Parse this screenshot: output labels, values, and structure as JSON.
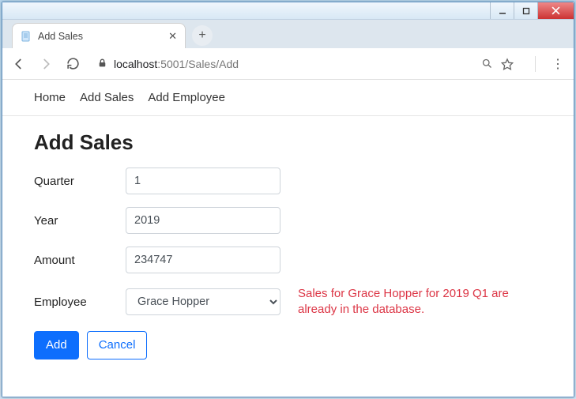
{
  "browser": {
    "tab_title": "Add Sales",
    "url_host": "localhost",
    "url_port": ":5001",
    "url_path": "/Sales/Add"
  },
  "nav": {
    "links": [
      "Home",
      "Add Sales",
      "Add Employee"
    ]
  },
  "page": {
    "heading": "Add Sales",
    "labels": {
      "quarter": "Quarter",
      "year": "Year",
      "amount": "Amount",
      "employee": "Employee"
    },
    "values": {
      "quarter": "1",
      "year": "2019",
      "amount": "234747",
      "employee": "Grace Hopper"
    },
    "error": "Sales for Grace Hopper for 2019 Q1 are already in the database.",
    "buttons": {
      "add": "Add",
      "cancel": "Cancel"
    }
  }
}
